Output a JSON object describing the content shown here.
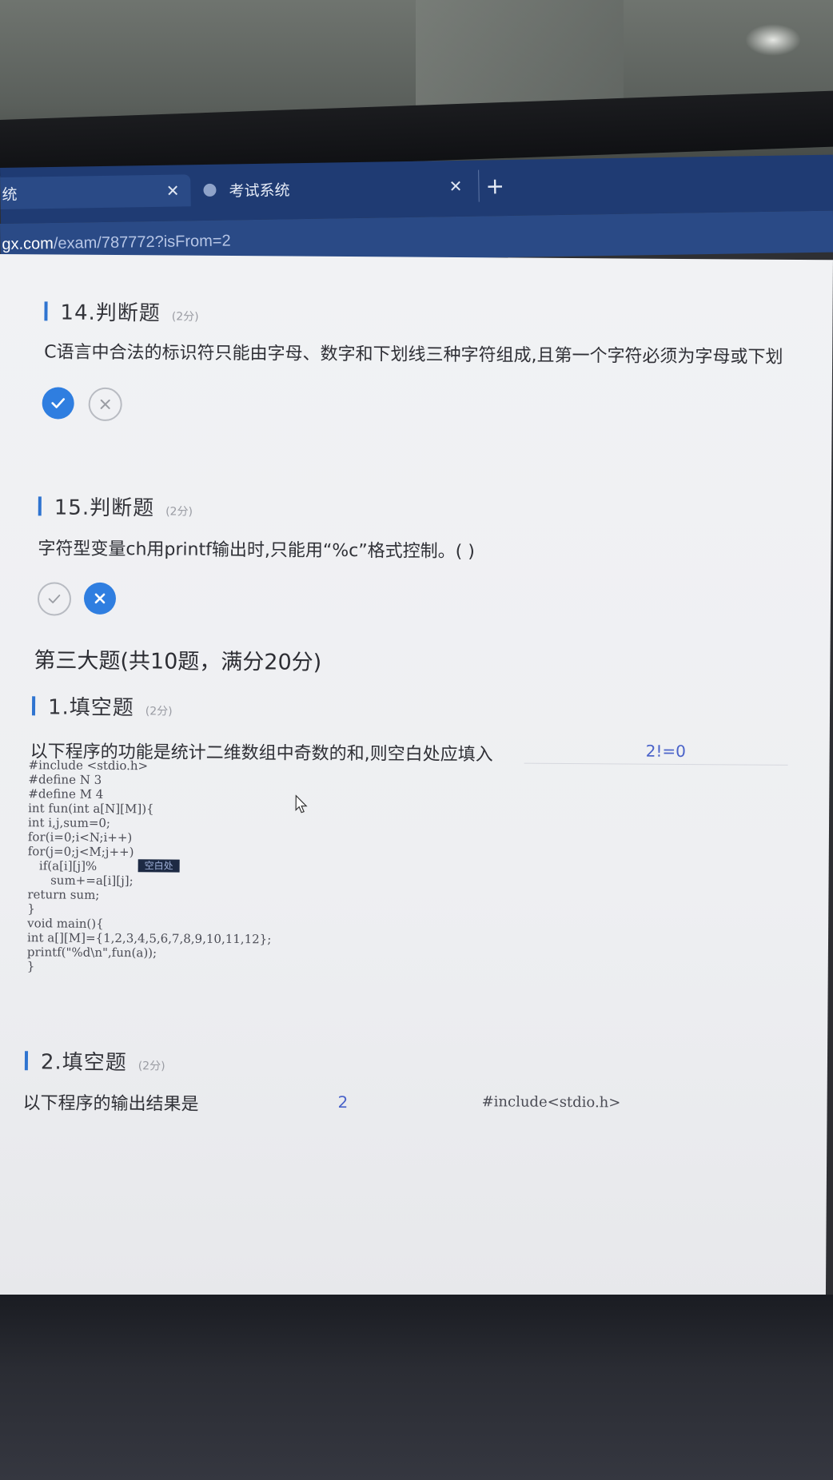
{
  "browser": {
    "tabs": [
      {
        "label": "统",
        "active": true
      },
      {
        "label": "考试系统",
        "active": false
      }
    ],
    "url_host": "gx.com",
    "url_path": "/exam/787772?isFrom=2"
  },
  "questions": [
    {
      "id": "q14",
      "number_title": "14.判断题",
      "points": "(2分)",
      "text": "C语言中合法的标识符只能由字母、数字和下划线三种字符组成,且第一个字符必须为字母或下划",
      "selected": "true"
    },
    {
      "id": "q15",
      "number_title": "15.判断题",
      "points": "(2分)",
      "text": "字符型变量ch用printf输出时,只能用“%c”格式控制。(   )",
      "selected": "false"
    }
  ],
  "section3": {
    "title": "第三大题(共10题，满分20分)",
    "fill1": {
      "number_title": "1.填空题",
      "points": "(2分)",
      "text": "以下程序的功能是统计二维数组中奇数的和,则空白处应填入",
      "answer": "2!=0",
      "code_lines": [
        "#include <stdio.h>",
        "#define N 3",
        "#define M 4",
        "int fun(int a[N][M]){",
        "int i,j,sum=0;",
        "for(i=0;i<N;i++)",
        "for(j=0;j<M;j++)",
        "   if(a[i][j]%",
        "      sum+=a[i][j];",
        "return sum;",
        "}",
        "void main(){",
        "int a[][M]={1,2,3,4,5,6,7,8,9,10,11,12};",
        "printf(\"%d\\n\",fun(a));",
        "}"
      ],
      "blank_label": "空白处"
    },
    "fill2": {
      "number_title": "2.填空题",
      "points": "(2分)",
      "text": "以下程序的输出结果是",
      "answer": "2",
      "code_start": "#include<stdio.h>"
    }
  },
  "colors": {
    "accent": "#2f7ee0",
    "tabbar": "#1f3b73",
    "answer": "#4a63c9"
  }
}
